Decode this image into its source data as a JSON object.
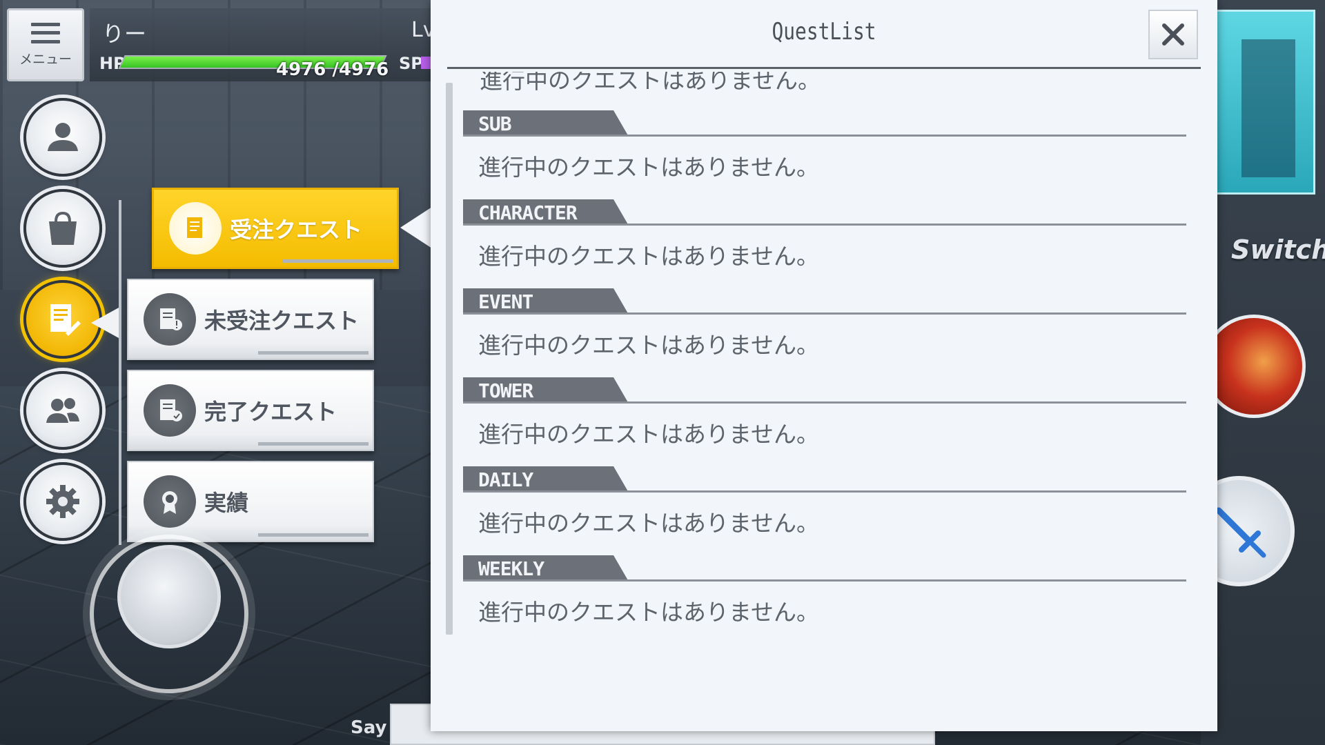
{
  "hud": {
    "menu_label": "メニュー",
    "player_name": "りー",
    "level_label": "Lv",
    "hp_label": "HP",
    "hp_value": "4976 /4976",
    "hp_fraction": 1.0,
    "sp_label": "SP",
    "say_label": "Say",
    "switch_label": "Switch"
  },
  "side_menu": {
    "items": [
      {
        "name": "profile",
        "icon": "person-icon",
        "active": false
      },
      {
        "name": "bag",
        "icon": "bag-icon",
        "active": false
      },
      {
        "name": "quest",
        "icon": "quest-note-icon",
        "active": true
      },
      {
        "name": "friends",
        "icon": "friends-icon",
        "active": false
      },
      {
        "name": "settings",
        "icon": "gear-icon",
        "active": false
      }
    ]
  },
  "quest_submenu": {
    "items": [
      {
        "label": "受注クエスト",
        "icon": "quest-accepted-icon",
        "active": true
      },
      {
        "label": "未受注クエスト",
        "icon": "quest-unaccepted-icon",
        "active": false
      },
      {
        "label": "完了クエスト",
        "icon": "quest-complete-icon",
        "active": false
      },
      {
        "label": "実績",
        "icon": "medal-icon",
        "active": false
      }
    ]
  },
  "dialog": {
    "title": "QuestList",
    "partial_top_message": "進行中のクエストはありません。",
    "sections": [
      {
        "tag": "SUB",
        "message": "進行中のクエストはありません。"
      },
      {
        "tag": "CHARACTER",
        "message": "進行中のクエストはありません。"
      },
      {
        "tag": "EVENT",
        "message": "進行中のクエストはありません。"
      },
      {
        "tag": "TOWER",
        "message": "進行中のクエストはありません。"
      },
      {
        "tag": "DAILY",
        "message": "進行中のクエストはありません。"
      },
      {
        "tag": "WEEKLY",
        "message": "進行中のクエストはありません。"
      }
    ]
  },
  "colors": {
    "accent_yellow": "#f4bc00",
    "hp_green": "#37c324",
    "sp_purple": "#b75ee8",
    "section_tag": "#6c7179"
  }
}
